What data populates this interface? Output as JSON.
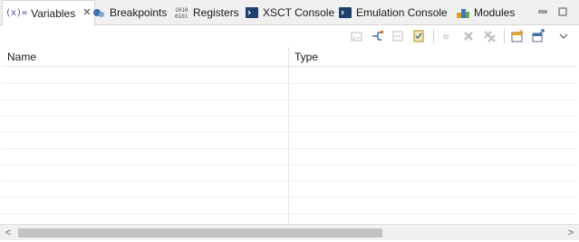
{
  "tabs": [
    {
      "label": "Variables",
      "icon": "variables-icon",
      "icon_text": "(x)=",
      "active": true,
      "closable": true
    },
    {
      "label": "Breakpoints",
      "icon": "breakpoints-icon",
      "active": false
    },
    {
      "label": "Registers",
      "icon": "registers-icon",
      "icon_text": "1010\n0101",
      "active": false
    },
    {
      "label": "XSCT Console",
      "icon": "console-icon",
      "active": false
    },
    {
      "label": "Emulation Console",
      "icon": "console-icon",
      "active": false
    },
    {
      "label": "Modules",
      "icon": "modules-icon",
      "active": false
    }
  ],
  "toolbar": {
    "buttons": [
      "show-type-names-icon",
      "show-logical-structure-icon",
      "collapse-all-icon",
      "select-all-icon",
      "add-global-variables-icon",
      "remove-icon",
      "remove-all-icon",
      "new-view-icon",
      "export-icon",
      "view-menu-icon"
    ]
  },
  "table": {
    "columns": [
      "Name",
      "Type"
    ],
    "rows": [
      {
        "name": "",
        "type": ""
      },
      {
        "name": "",
        "type": ""
      },
      {
        "name": "",
        "type": ""
      },
      {
        "name": "",
        "type": ""
      },
      {
        "name": "",
        "type": ""
      },
      {
        "name": "",
        "type": ""
      },
      {
        "name": "",
        "type": ""
      },
      {
        "name": "",
        "type": ""
      },
      {
        "name": "",
        "type": ""
      }
    ]
  },
  "scrollbar": {
    "left_arrow": "<",
    "right_arrow": ">"
  },
  "colors": {
    "accent": "#5a3d9a",
    "tab_bg": "#f0f0f0",
    "console_blue": "#1f3f6e"
  }
}
